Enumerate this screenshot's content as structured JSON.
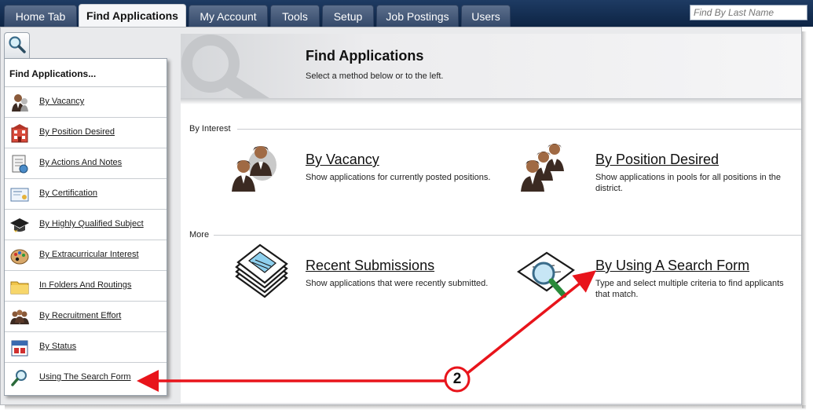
{
  "tabs": [
    {
      "label": "Home Tab"
    },
    {
      "label": "Find Applications"
    },
    {
      "label": "My Account"
    },
    {
      "label": "Tools"
    },
    {
      "label": "Setup"
    },
    {
      "label": "Job Postings"
    },
    {
      "label": "Users"
    }
  ],
  "search": {
    "placeholder": "Find By Last Name"
  },
  "sidebar": {
    "title": "Find Applications...",
    "items": [
      {
        "label": "By Vacancy",
        "icon": "person-icon"
      },
      {
        "label": "By Position Desired",
        "icon": "building-icon"
      },
      {
        "label": "By Actions And Notes",
        "icon": "notes-icon"
      },
      {
        "label": "By Certification",
        "icon": "certificate-icon"
      },
      {
        "label": "By Highly Qualified Subject",
        "icon": "graduation-cap-icon"
      },
      {
        "label": "By Extracurricular Interest",
        "icon": "palette-icon"
      },
      {
        "label": "In Folders And Routings",
        "icon": "folder-icon"
      },
      {
        "label": "By Recruitment Effort",
        "icon": "group-icon"
      },
      {
        "label": "By Status",
        "icon": "calendar-icon"
      },
      {
        "label": "Using The Search Form",
        "icon": "magnifier-icon"
      }
    ]
  },
  "main": {
    "title": "Find Applications",
    "subtitle": "Select a method below or to the left.",
    "sections": [
      {
        "label": "By Interest"
      },
      {
        "label": "More"
      }
    ],
    "options": [
      {
        "title": "By Vacancy",
        "description": "Show applications for currently posted positions."
      },
      {
        "title": "By Position Desired",
        "description": "Show applications in pools for all positions in the district."
      },
      {
        "title": "Recent Submissions",
        "description": "Show applications that were recently submitted."
      },
      {
        "title": "By Using A Search Form",
        "description": "Type and select multiple criteria to find applicants that match."
      }
    ]
  },
  "annotation": {
    "number": "2",
    "color": "#e8141b"
  },
  "colors": {
    "tabbar": "#0d2444",
    "active_tab": "#f5f6f8",
    "panel": "#e9eaec"
  }
}
